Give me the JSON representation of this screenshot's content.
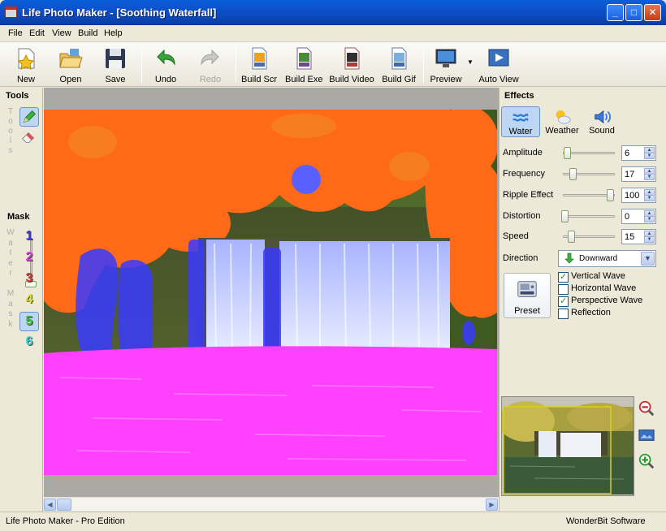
{
  "window": {
    "title": "Life Photo Maker - [Soothing Waterfall]",
    "minimize": "_",
    "maximize": "□",
    "close": "✕"
  },
  "menu": [
    "File",
    "Edit",
    "View",
    "Build",
    "Help"
  ],
  "toolbar": {
    "new": "New",
    "open": "Open",
    "save": "Save",
    "undo": "Undo",
    "redo": "Redo",
    "build_scr": "Build Scr",
    "build_exe": "Build Exe",
    "build_video": "Build Video",
    "build_gif": "Build Gif",
    "preview": "Preview",
    "auto_view": "Auto View"
  },
  "tools": {
    "title": "Tools",
    "vertical": "Tools",
    "mask_title": "Mask",
    "mask_vertical": "Water Mask",
    "mask_numbers": [
      "1",
      "2",
      "3",
      "4",
      "5",
      "6"
    ],
    "mask_colors": [
      "#3a3ad8",
      "#e040e0",
      "#e03030",
      "#e0e030",
      "#30c830",
      "#30d8d8"
    ],
    "selected_mask": "5"
  },
  "effects": {
    "title": "Effects",
    "tabs": [
      "Water",
      "Weather",
      "Sound"
    ],
    "active_tab": "Water",
    "params": [
      {
        "label": "Amplitude",
        "value": "6",
        "fraction": 0.06
      },
      {
        "label": "Frequency",
        "value": "17",
        "fraction": 0.17
      },
      {
        "label": "Ripple Effect",
        "value": "100",
        "fraction": 1.0
      },
      {
        "label": "Distortion",
        "value": "0",
        "fraction": 0.0
      },
      {
        "label": "Speed",
        "value": "15",
        "fraction": 0.15
      }
    ],
    "direction_label": "Direction",
    "direction_value": "Downward",
    "preset_label": "Preset",
    "checkboxes": [
      {
        "label": "Vertical Wave",
        "checked": true
      },
      {
        "label": "Horizontal Wave",
        "checked": false
      },
      {
        "label": "Perspective Wave",
        "checked": true
      },
      {
        "label": "Reflection",
        "checked": false
      }
    ]
  },
  "status": {
    "left": "Life Photo Maker - Pro Edition",
    "right": "WonderBit Software"
  }
}
